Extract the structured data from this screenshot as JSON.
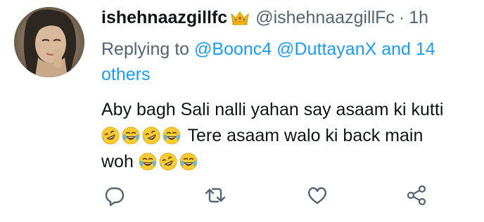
{
  "tweet": {
    "display_name": "ishehnaazgillfc",
    "handle": "@ishehnaazgillFc",
    "separator": "·",
    "time": "1h",
    "replying_prefix": "Replying to ",
    "mention_1": "@Boonc4",
    "mention_2": "@DuttayanX",
    "mention_more": "and 14 others",
    "line_1": "Aby bagh Sali nalli yahan say asaam ki kutti",
    "line_2": "Tere asaam walo ki back main",
    "line_3": "woh"
  },
  "icons": {
    "badge": "crown-emoji",
    "reply": "reply-icon",
    "retweet": "retweet-icon",
    "like": "heart-icon",
    "share": "share-icon"
  },
  "colors": {
    "primary_text": "#0f1419",
    "secondary_text": "#536471",
    "link": "#1d9bf0",
    "background": "#ffffff"
  }
}
